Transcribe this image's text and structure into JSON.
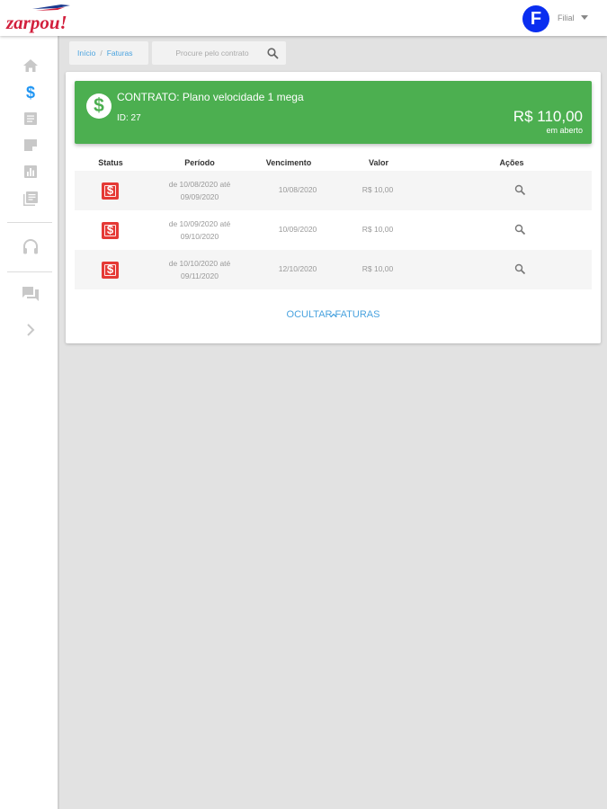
{
  "header": {
    "logo_text": "zarpou!",
    "avatar_letter": "F",
    "user_name": "Filial"
  },
  "sidebar": {
    "items": [
      {
        "icon": "home-icon",
        "active": false
      },
      {
        "icon": "dollar-icon",
        "active": true
      },
      {
        "icon": "document-icon",
        "active": false
      },
      {
        "icon": "note-icon",
        "active": false
      },
      {
        "icon": "bar-chart-icon",
        "active": false
      },
      {
        "icon": "library-icon",
        "active": false
      },
      {
        "icon": "headset-icon",
        "active": false
      },
      {
        "icon": "chat-icon",
        "active": false
      },
      {
        "icon": "chevron-right-icon",
        "active": false
      }
    ],
    "active_color": "#2196f3",
    "icon_color": "#c8c8c8"
  },
  "breadcrumb": {
    "items": [
      "Início",
      "Faturas"
    ],
    "separator": "/"
  },
  "search": {
    "placeholder": "Procure pelo contrato",
    "value": ""
  },
  "contract": {
    "title": "CONTRATO: Plano velocidade 1 mega",
    "id_label": "ID: 27",
    "amount": "R$ 110,00",
    "amount_status": "em aberto",
    "color": "#4caf50"
  },
  "table": {
    "headers": [
      "Status",
      "Período",
      "Vencimento",
      "Valor",
      "Ações"
    ],
    "rows": [
      {
        "status_icon": "dollar-icon",
        "period_line1": "de 10/08/2020 até",
        "period_line2": "09/09/2020",
        "due": "10/08/2020",
        "value": "R$ 10,00"
      },
      {
        "status_icon": "dollar-icon",
        "period_line1": "de 10/09/2020 até",
        "period_line2": "09/10/2020",
        "due": "10/09/2020",
        "value": "R$ 10,00"
      },
      {
        "status_icon": "dollar-icon",
        "period_line1": "de 10/10/2020 até",
        "period_line2": "09/11/2020",
        "due": "12/10/2020",
        "value": "R$ 10,00"
      }
    ],
    "status_color": "#e53935"
  },
  "hide_invoices_label": "OCULTAR FATURAS",
  "accent_color": "#4aa3df"
}
